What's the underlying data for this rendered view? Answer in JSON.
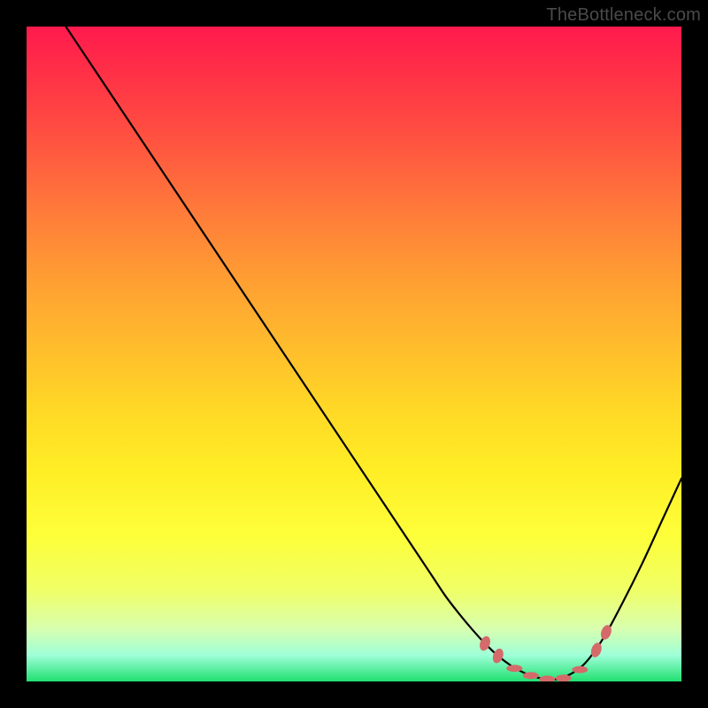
{
  "watermark": "TheBottleneck.com",
  "colors": {
    "curve": "#000000",
    "marker_fill": "#d46a6a",
    "gradient_top": "#ff1a4d",
    "gradient_bottom": "#20e070"
  },
  "chart_data": {
    "type": "line",
    "title": "",
    "xlabel": "",
    "ylabel": "",
    "xlim": [
      0,
      100
    ],
    "ylim": [
      0,
      100
    ],
    "x": [
      6,
      10,
      15,
      20,
      25,
      30,
      35,
      40,
      45,
      50,
      55,
      60,
      62,
      64,
      66,
      68,
      70,
      72,
      74,
      76,
      78,
      80,
      82,
      85,
      88,
      91,
      94,
      97,
      100
    ],
    "y": [
      100,
      94,
      86.5,
      79,
      71.5,
      64,
      56.5,
      49,
      41.5,
      34,
      26.5,
      19,
      16,
      13,
      10.4,
      8,
      5.8,
      3.9,
      2.4,
      1.3,
      0.6,
      0.3,
      0.6,
      2.5,
      6.5,
      12,
      18,
      24.5,
      31
    ],
    "markers": [
      {
        "x": 70,
        "y": 5.8,
        "shape": "ellipse"
      },
      {
        "x": 72,
        "y": 3.9,
        "shape": "ellipse"
      },
      {
        "x": 74.5,
        "y": 2.0,
        "shape": "dash"
      },
      {
        "x": 77,
        "y": 0.9,
        "shape": "dash"
      },
      {
        "x": 79.5,
        "y": 0.35,
        "shape": "dash"
      },
      {
        "x": 82,
        "y": 0.5,
        "shape": "dash"
      },
      {
        "x": 84.5,
        "y": 1.8,
        "shape": "dash"
      },
      {
        "x": 87,
        "y": 4.8,
        "shape": "ellipse"
      },
      {
        "x": 88.5,
        "y": 7.5,
        "shape": "ellipse"
      }
    ],
    "notes": "Gradient background runs red (high bottleneck) at top to green (balanced) at bottom. Curve minimum near x≈80 indicates optimal pairing. Y values estimated from pixel positions; no axis ticks visible."
  }
}
